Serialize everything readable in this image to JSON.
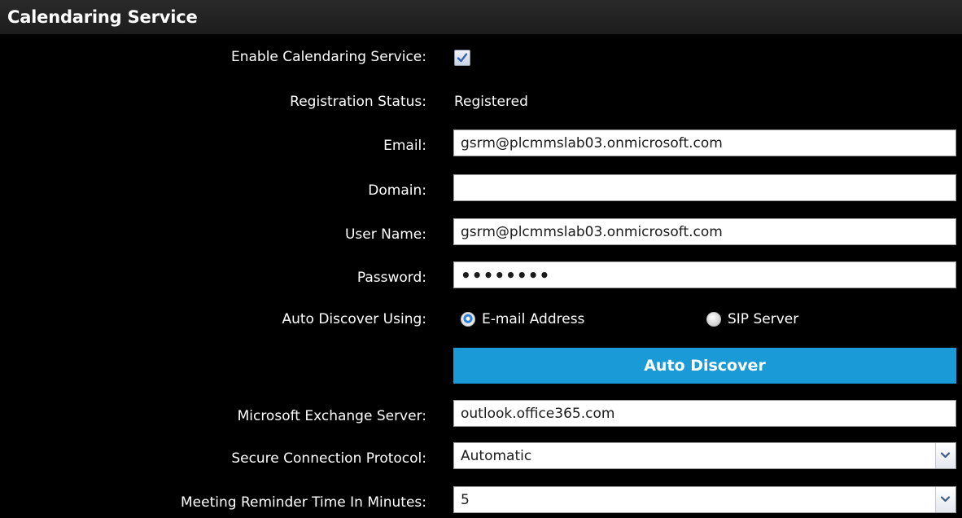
{
  "header": {
    "title": "Calendaring Service"
  },
  "form": {
    "enable_calendaring": {
      "label": "Enable Calendaring Service:",
      "checked": true
    },
    "registration_status": {
      "label": "Registration Status:",
      "value": "Registered"
    },
    "email": {
      "label": "Email:",
      "value": "gsrm@plcmmslab03.onmicrosoft.com"
    },
    "domain": {
      "label": "Domain:",
      "value": ""
    },
    "user_name": {
      "label": "User Name:",
      "value": "gsrm@plcmmslab03.onmicrosoft.com"
    },
    "password": {
      "label": "Password:",
      "value": "••••••••"
    },
    "auto_discover_using": {
      "label": "Auto Discover Using:",
      "options": [
        {
          "label": "E-mail Address",
          "selected": true
        },
        {
          "label": "SIP Server",
          "selected": false
        }
      ]
    },
    "auto_discover_button": {
      "label": "Auto Discover"
    },
    "exchange_server": {
      "label": "Microsoft Exchange Server:",
      "value": "outlook.office365.com"
    },
    "secure_protocol": {
      "label": "Secure Connection Protocol:",
      "selected": "Automatic"
    },
    "reminder_time": {
      "label": "Meeting Reminder Time In Minutes:",
      "selected": "5"
    }
  },
  "icons": {
    "checkbox_check": "check-icon",
    "dropdown": "chevron-down-icon"
  },
  "colors": {
    "background": "#000000",
    "accent_button": "#1a9ad6",
    "radio_selected": "#2d7fd6",
    "check_mark": "#3a63b8"
  }
}
